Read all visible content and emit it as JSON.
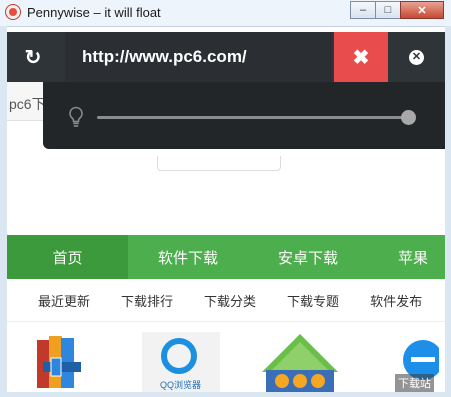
{
  "window": {
    "title": "Pennywise – it will float",
    "controls": {
      "minimize": "–",
      "maximize": "□",
      "close": "✕"
    }
  },
  "pennywise": {
    "url_value": "http://www.pc6.com/",
    "refresh_icon": "refresh-icon",
    "clear_icon": "times-icon",
    "close_icon": "times-circle-icon",
    "opacity_icon": "lightbulb-icon",
    "opacity_level": 1.0,
    "colors": {
      "topbar": "#2f3439",
      "clear": "#e84c4c",
      "slider_panel": "#232629"
    }
  },
  "webpage": {
    "tab_text": "pc6下",
    "nav": {
      "items": [
        "首页",
        "软件下载",
        "安卓下载",
        "苹果"
      ],
      "active_index": 0,
      "color": "#4cae4c"
    },
    "subnav": [
      "最近更新",
      "下载排行",
      "下载分类",
      "下载专题",
      "软件发布"
    ],
    "apps": [
      {
        "icon": "winrar-icon"
      },
      {
        "icon": "qq-browser-icon",
        "label": "QQ浏览器"
      },
      {
        "icon": "wps-icon"
      },
      {
        "icon": "ie-icon"
      }
    ],
    "corner_badge": "下载站"
  }
}
